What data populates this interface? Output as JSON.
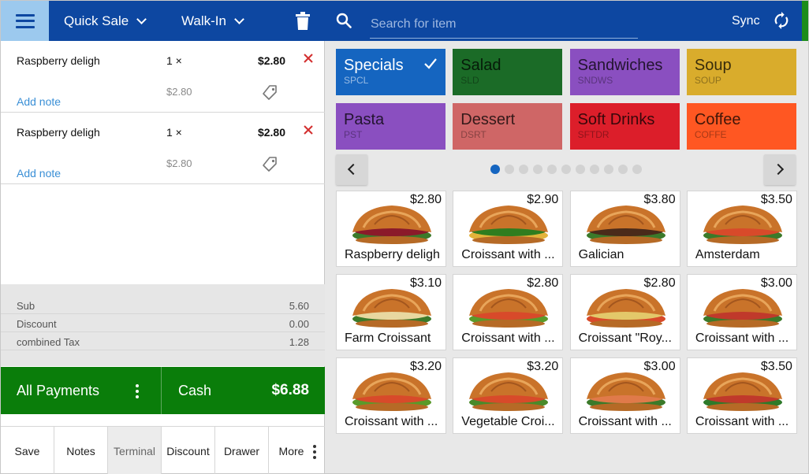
{
  "colors": {
    "primary": "#0d47a1",
    "menu_btn": "#9cc9ee",
    "pay_green": "#0a7d0a",
    "remove_red": "#d32f2f",
    "link_blue": "#3a8fd6"
  },
  "header": {
    "sale_type": "Quick Sale",
    "customer": "Walk-In"
  },
  "cart": {
    "items": [
      {
        "name": "Raspberry deligh",
        "qty": "1 ×",
        "total": "$2.80",
        "unit_price": "$2.80",
        "note_link": "Add note"
      },
      {
        "name": "Raspberry deligh",
        "qty": "1 ×",
        "total": "$2.80",
        "unit_price": "$2.80",
        "note_link": "Add note"
      }
    ]
  },
  "totals": [
    {
      "label": "Sub",
      "value": "5.60"
    },
    {
      "label": "Discount",
      "value": "0.00"
    },
    {
      "label": "combined Tax",
      "value": "1.28"
    }
  ],
  "payment": {
    "all_payments": "All Payments",
    "cash": "Cash",
    "amount": "$6.88"
  },
  "bottom_buttons": [
    "Save",
    "Notes",
    "Terminal",
    "Discount",
    "Drawer",
    "More"
  ],
  "search": {
    "placeholder": "Search for item"
  },
  "sync": {
    "label": "Sync"
  },
  "categories": [
    {
      "name": "Specials",
      "code": "SPCL",
      "color": "#1565c0",
      "selected": true
    },
    {
      "name": "Salad",
      "code": "SLD",
      "color": "#1b6b27"
    },
    {
      "name": "Sandwiches",
      "code": "SNDWS",
      "color": "#8a4fc0"
    },
    {
      "name": "Soup",
      "code": "SOUP",
      "color": "#d9ac2c"
    },
    {
      "name": "Pasta",
      "code": "PST",
      "color": "#8a4fc0"
    },
    {
      "name": "Dessert",
      "code": "DSRT",
      "color": "#cf6666"
    },
    {
      "name": "Soft Drinks",
      "code": "SFTDR",
      "color": "#dc1e2a"
    },
    {
      "name": "Coffee",
      "code": "COFFE",
      "color": "#ff5722"
    }
  ],
  "pagination": {
    "current": 1,
    "total": 11
  },
  "items": [
    {
      "name": "Raspberry deligh",
      "price": "$2.80"
    },
    {
      "name": "Croissant with ...",
      "price": "$2.90"
    },
    {
      "name": "Galician",
      "price": "$3.80"
    },
    {
      "name": "Amsterdam",
      "price": "$3.50"
    },
    {
      "name": "Farm Croissant",
      "price": "$3.10"
    },
    {
      "name": "Croissant with ...",
      "price": "$2.80"
    },
    {
      "name": "Croissant \"Roy...",
      "price": "$2.80"
    },
    {
      "name": "Croissant with ...",
      "price": "$3.00"
    },
    {
      "name": "Croissant with ...",
      "price": "$3.20"
    },
    {
      "name": "Vegetable Croi...",
      "price": "$3.20"
    },
    {
      "name": "Croissant with ...",
      "price": "$3.00"
    },
    {
      "name": "Croissant with ...",
      "price": "$3.50"
    }
  ]
}
